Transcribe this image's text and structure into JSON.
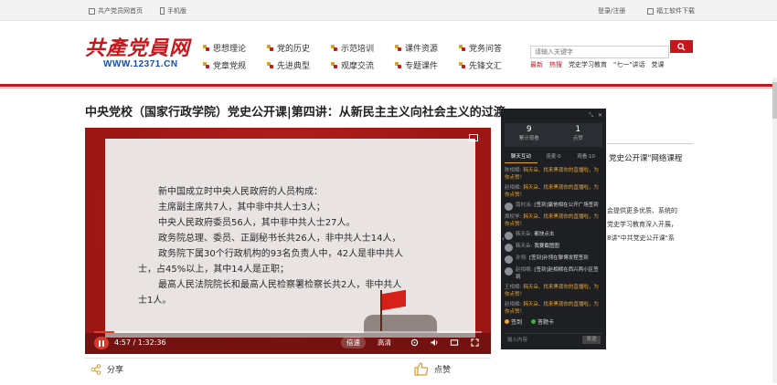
{
  "topbar": {
    "home_link": "共产党员网首页",
    "mobile_link": "手机版",
    "login": "登录/注册",
    "download": "福工软件下载"
  },
  "header": {
    "logo_text": "共產党員网",
    "logo_url": "WWW.12371.CN",
    "nav": [
      "思想理论",
      "党的历史",
      "示范培训",
      "课件资源",
      "党务问答",
      "党章党规",
      "先进典型",
      "观摩交流",
      "专题课件",
      "先锋文汇"
    ],
    "search_placeholder": "请输入关键字",
    "hot": [
      "最新",
      "热搜",
      "党史学习教育",
      "\"七一\"讲话",
      "党课"
    ]
  },
  "video": {
    "title": "中央党校（国家行政学院）党史公开课|第四讲：从新民主主义向社会主义的过渡",
    "slide_lines": [
      "新中国成立时中央人民政府的人员构成：",
      "主席副主席共7人，其中非中共人士3人；",
      "中央人民政府委员56人，其中非中共人士27人。",
      "政务院总理、委员、正副秘书长共26人，非中共人士14人，",
      "政务院下属30个行政机构的93名负责人中，42人是非中共人",
      "士，占45%以上，其中14人是正职；",
      "最高人民法院院长和最高人民检察署检察长共2人，非中共人",
      "士1人。"
    ],
    "time": "4:57 / 1:32:36",
    "progress": 0.053,
    "speed_label": "倍速",
    "quality_label": "高清"
  },
  "actions": {
    "share": "分享",
    "like": "点赞"
  },
  "chat": {
    "stats": [
      {
        "num": "9",
        "label": "累计观看"
      },
      {
        "num": "1",
        "label": "点赞"
      }
    ],
    "tabs": [
      "聊天互动",
      "连麦·0",
      "观看·10"
    ],
    "messages": [
      {
        "who": "陈相樑:",
        "text": "韩天朵、找来黑现你的直播啦，为你点赞！",
        "orange": true,
        "avatar": false
      },
      {
        "who": "赵相樑:",
        "text": "韩天朵、找来黑现你的直播啦，为你点赞！",
        "orange": true,
        "avatar": false
      },
      {
        "who": "南村派:",
        "text": "[签到]赢他相在公开广场签到",
        "orange": false,
        "avatar": true
      },
      {
        "who": "周权学:",
        "text": "韩天朵、找来黑现你的直播啦，为你点赞！",
        "orange": true,
        "avatar": false
      },
      {
        "who": "韩天朵:",
        "text": "都快点击",
        "orange": false,
        "avatar": true
      },
      {
        "who": "韩天朵:",
        "text": "我要截图图",
        "orange": false,
        "avatar": true
      },
      {
        "who": "孙翎:",
        "text": "[签到]孙翎在聊博发程签到",
        "orange": false,
        "avatar": true
      },
      {
        "who": "赵相樑:",
        "text": "[签到]赵相樑在西兴两小区签到",
        "orange": false,
        "avatar": true
      },
      {
        "who": "王相樑:",
        "text": "韩天朵、找来黑现你的直播啦，为你点赞！",
        "orange": true,
        "avatar": false
      },
      {
        "who": "赵相樑:",
        "text": "韩天朵、找来黑现你的直播啦，为你点赞！",
        "orange": true,
        "avatar": false
      }
    ],
    "sign_in": "签到",
    "clock_in": "答题卡",
    "input_placeholder": "输入内容",
    "send": "发送"
  },
  "side": {
    "title": "党史公开课\"网络课程",
    "text_lines": [
      "会提供更多优质、系统的",
      "党史学习教育深入开展，",
      "8讲\"中共党史公开课\"系"
    ]
  }
}
